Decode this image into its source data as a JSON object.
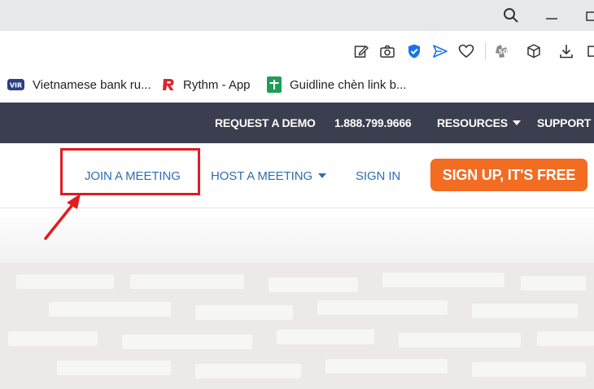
{
  "browser": {
    "icons": {
      "search": "search-icon",
      "minimize": "minimize-icon",
      "maximize": "maximize-icon"
    }
  },
  "toolbar": {
    "icons": [
      "edit-icon",
      "camera-icon",
      "shield-icon",
      "send-icon",
      "heart-icon",
      "extension-icon",
      "cube-icon",
      "download-icon",
      "screenshot-icon"
    ],
    "shield_color": "#1a73e8",
    "send_color": "#1a73e8"
  },
  "bookmarks": {
    "items": [
      {
        "label": "Vietnamese bank ru...",
        "icon": "vir-icon"
      },
      {
        "label": "Rythm - App",
        "icon": "rythm-logo-icon"
      },
      {
        "label": "Guidline chèn link b...",
        "icon": "google-sheets-icon"
      }
    ],
    "vir_badge": "VIR"
  },
  "site": {
    "topbar": {
      "request_demo": "REQUEST A DEMO",
      "phone": "1.888.799.9666",
      "resources": "RESOURCES",
      "support": "SUPPORT",
      "bg_color": "#3b3e4f"
    },
    "nav": {
      "join_meeting": "JOIN A MEETING",
      "host_meeting": "HOST A MEETING",
      "sign_in": "SIGN IN",
      "signup": "SIGN UP, IT'S FREE",
      "link_color": "#2d6db5",
      "signup_color": "#f26c22"
    }
  },
  "annotation": {
    "highlight_color": "#e11b22"
  }
}
